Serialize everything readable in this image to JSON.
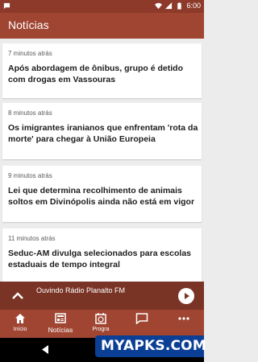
{
  "status_bar": {
    "time": "6:00",
    "icons": [
      "notification-icon",
      "wifi-icon",
      "signal-icon",
      "battery-icon"
    ]
  },
  "app_bar": {
    "title": "Notícias"
  },
  "articles": [
    {
      "time": "7 minutos atrás",
      "headline": "Após abordagem de ônibus, grupo é detido com drogas em Vassouras"
    },
    {
      "time": "8 minutos atrás",
      "headline": "Os imigrantes iranianos que enfrentam 'rota da morte' para chegar à União Europeia"
    },
    {
      "time": "9 minutos atrás",
      "headline": "Lei que determina recolhimento de animais soltos em Divinópolis ainda não está em vigor"
    },
    {
      "time": "11 minutos atrás",
      "headline": "Seduc-AM divulga selecionados para escolas estaduais de tempo integral"
    }
  ],
  "player": {
    "label": "Ouvindo Rádio Planalto FM"
  },
  "bottom_nav": {
    "items": [
      {
        "label": "Início",
        "icon": "home-icon"
      },
      {
        "label": "Notícias",
        "icon": "news-icon"
      },
      {
        "label": "Progra",
        "icon": "schedule-icon"
      },
      {
        "label": "",
        "icon": "chat-icon"
      },
      {
        "label": "",
        "icon": "more-icon"
      }
    ]
  },
  "watermark": {
    "text": "MYAPKS.COM"
  },
  "colors": {
    "status_bar": "#8d3a2a",
    "app_bar": "#a04532",
    "player": "#7a3426",
    "background": "#ececec",
    "watermark": "#0b3f95"
  }
}
